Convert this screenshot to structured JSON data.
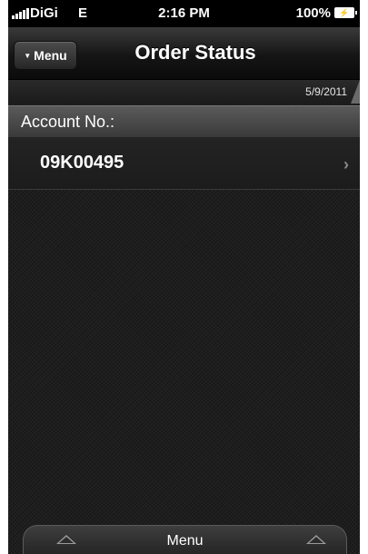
{
  "status_bar": {
    "carrier": "DiGi",
    "network": "E",
    "time": "2:16 PM",
    "battery": "100%"
  },
  "nav": {
    "menu_label": "Menu",
    "title": "Order Status"
  },
  "date": "5/9/2011",
  "section": {
    "label": "Account No.:"
  },
  "account": {
    "number": "09K00495"
  },
  "bottom_menu": {
    "label": "Menu"
  },
  "icons": {
    "signal": "signal-bars-icon",
    "battery": "battery-charging-icon",
    "menu_toggle": "triangle-down-icon",
    "row_disclosure": "chevron-right-icon",
    "tab_expand": "triangle-up-icon"
  }
}
